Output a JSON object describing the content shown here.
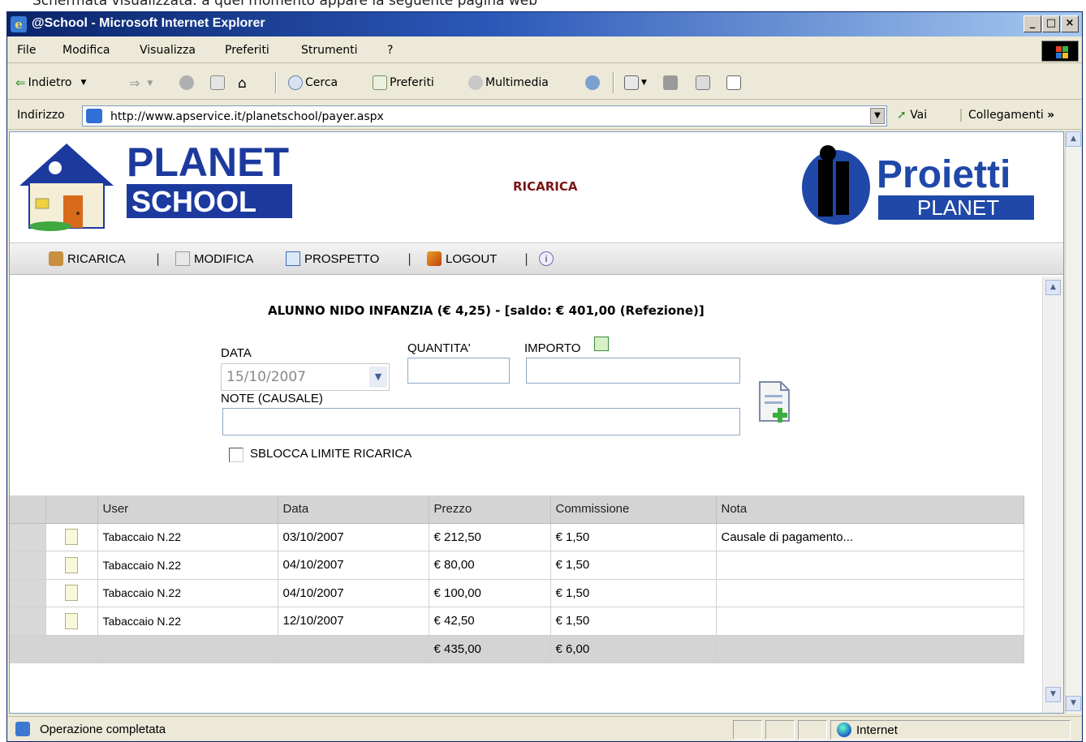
{
  "caption": "Schermata visualizzata: a quel momento appare la seguente pagina web",
  "window": {
    "title": "@School - Microsoft Internet Explorer",
    "minimize": "_",
    "maximize": "□",
    "close": "×"
  },
  "menu": [
    "File",
    "Modifica",
    "Visualizza",
    "Preferiti",
    "Strumenti",
    "?"
  ],
  "toolbar": {
    "back": "Indietro",
    "search": "Cerca",
    "favorites": "Preferiti",
    "media": "Multimedia"
  },
  "address": {
    "label": "Indirizzo",
    "url": "http://www.apservice.it/planetschool/payer.aspx",
    "go": "Vai",
    "links": "Collegamenti",
    "more": "»"
  },
  "header": {
    "logo_line1": "PLANET",
    "logo_line2": "SCHOOL",
    "page_title": "RICARICA",
    "brand_name": "Proietti",
    "brand_sub": "PLANET"
  },
  "nav": {
    "ricarica": "RICARICA",
    "modifica": "MODIFICA",
    "prospetto": "PROSPETTO",
    "logout": "LOGOUT",
    "separator": "|"
  },
  "student_line": "ALUNNO NIDO INFANZIA (€ 4,25) - [saldo: € 401,00 (Refezione)]",
  "form": {
    "date_label": "DATA",
    "date_value": "15/10/2007",
    "qty_label": "QUANTITA'",
    "amount_label": "IMPORTO",
    "note_label": "NOTE (CAUSALE)",
    "unlock_label": "SBLOCCA LIMITE RICARICA",
    "unlock_checked": false
  },
  "table": {
    "headers": [
      "User",
      "Data",
      "Prezzo",
      "Commissione",
      "Nota"
    ],
    "rows": [
      {
        "user": "Tabaccaio N.22",
        "date": "03/10/2007",
        "price": "€ 212,50",
        "fee": "€ 1,50",
        "note": "Causale di pagamento..."
      },
      {
        "user": "Tabaccaio N.22",
        "date": "04/10/2007",
        "price": "€ 80,00",
        "fee": "€ 1,50",
        "note": ""
      },
      {
        "user": "Tabaccaio N.22",
        "date": "04/10/2007",
        "price": "€ 100,00",
        "fee": "€ 1,50",
        "note": ""
      },
      {
        "user": "Tabaccaio N.22",
        "date": "12/10/2007",
        "price": "€ 42,50",
        "fee": "€ 1,50",
        "note": ""
      }
    ],
    "total_price": "€ 435,00",
    "total_fee": "€ 6,00"
  },
  "status": {
    "text": "Operazione completata",
    "zone": "Internet"
  },
  "colors": {
    "titlebar": "#0a246a",
    "page_title": "#7b1414",
    "planet_blue": "#1c3a9e",
    "proietti_blue": "#1f48a8"
  }
}
